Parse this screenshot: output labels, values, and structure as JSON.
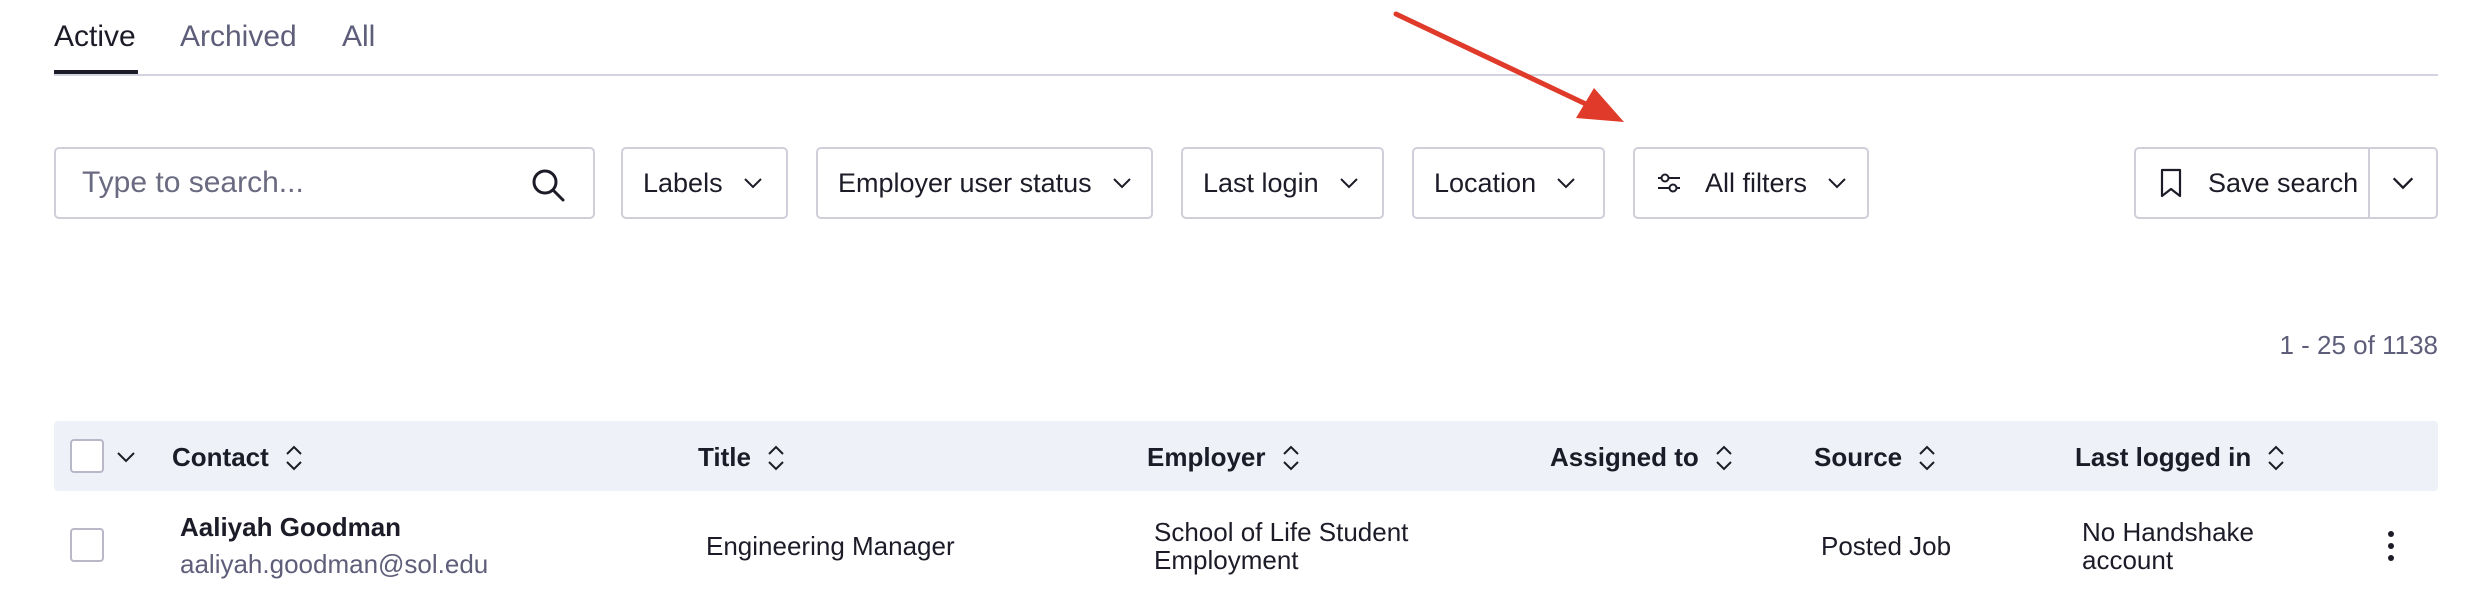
{
  "tabs": [
    {
      "label": "Active",
      "active": true
    },
    {
      "label": "Archived",
      "active": false
    },
    {
      "label": "All",
      "active": false
    }
  ],
  "search": {
    "placeholder": "Type to search...",
    "value": ""
  },
  "filters": {
    "labels": "Labels",
    "employer_user_status": "Employer user status",
    "last_login": "Last login",
    "location": "Location",
    "all_filters": "All filters"
  },
  "save_search": {
    "label": "Save search"
  },
  "pagination": {
    "text": "1 - 25 of 1138"
  },
  "table": {
    "columns": [
      "Contact",
      "Title",
      "Employer",
      "Assigned to",
      "Source",
      "Last logged in"
    ],
    "rows": [
      {
        "name": "Aaliyah Goodman",
        "email": "aaliyah.goodman@sol.edu",
        "title": "Engineering Manager",
        "employer_line1": "School of Life Student",
        "employer_line2": "Employment",
        "assigned_to": "",
        "source": "Posted Job",
        "last_logged_in_line1": "No Handshake",
        "last_logged_in_line2": "account"
      }
    ]
  },
  "colors": {
    "text_primary": "#1c1c28",
    "text_secondary": "#5e5e7a",
    "border": "#cfcfda",
    "table_header_bg": "#eef1f8",
    "annotation_arrow": "#e03a2a"
  },
  "icons": [
    "search-icon",
    "chevron-down-icon",
    "sliders-icon",
    "bookmark-icon",
    "sort-icon",
    "kebab-menu-icon",
    "annotation-arrow"
  ]
}
